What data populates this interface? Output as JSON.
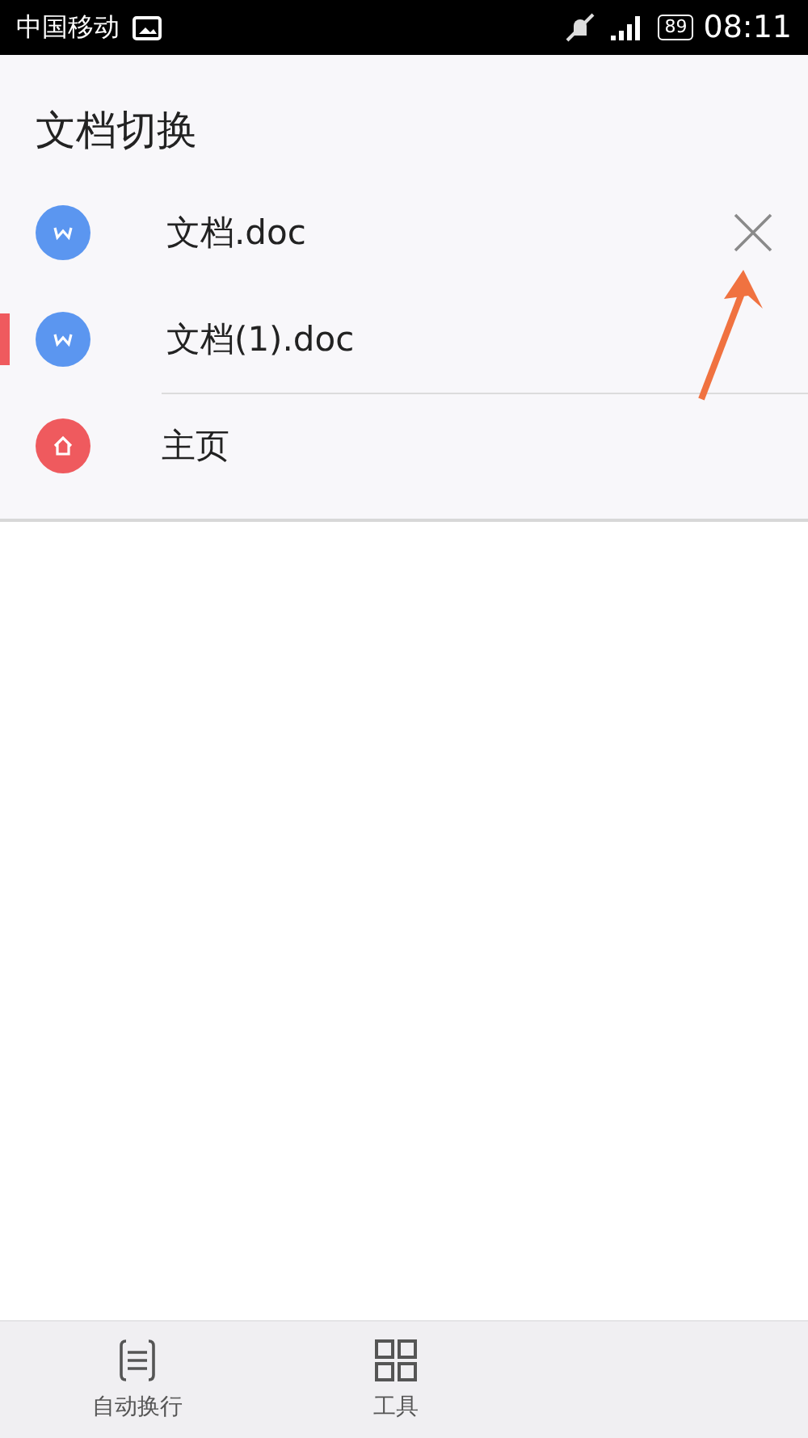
{
  "status_bar": {
    "carrier": "中国移动",
    "battery": "89",
    "time": "08:11"
  },
  "panel": {
    "title": "文档切换",
    "items": [
      {
        "label": "文档.doc",
        "kind": "doc",
        "selected": false,
        "closable": true
      },
      {
        "label": "文档(1).doc",
        "kind": "doc",
        "selected": true,
        "closable": false
      },
      {
        "label": "主页",
        "kind": "home",
        "selected": false,
        "closable": false
      }
    ]
  },
  "bottom_bar": [
    {
      "label": "自动换行",
      "kind": "wrap"
    },
    {
      "label": "工具",
      "kind": "tools"
    }
  ]
}
